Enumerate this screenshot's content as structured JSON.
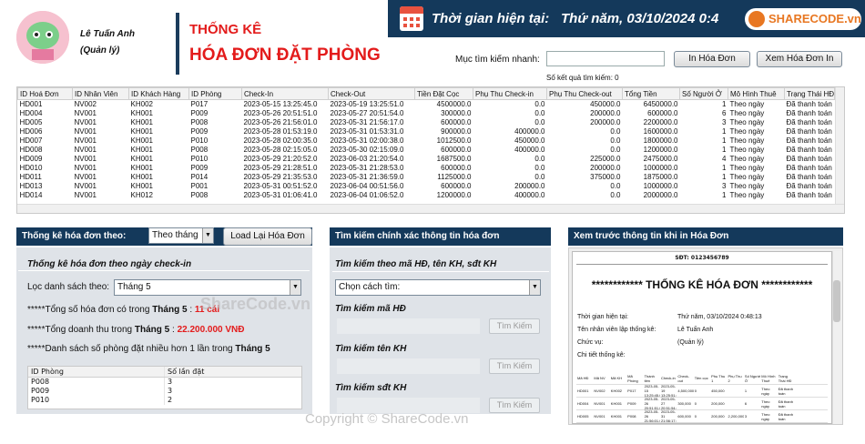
{
  "user": {
    "name": "Lê Tuấn Anh",
    "role": "(Quản lý)"
  },
  "title": {
    "line1": "THỐNG KÊ",
    "line2": "HÓA ĐƠN ĐẶT PHÒNG"
  },
  "time_bar": {
    "label": "Thời gian hiện tại:",
    "value": "Thứ năm, 03/10/2024 0:4",
    "logo": "SHARECODE.vn"
  },
  "search": {
    "label": "Mục tìm kiếm nhanh:",
    "value": "",
    "result_count": "Số kết quả tìm kiếm: 0",
    "print_label": "In Hóa Đơn",
    "preview_label": "Xem Hóa Đơn In"
  },
  "invoice_table": {
    "columns": [
      "ID Hoá Đơn",
      "ID Nhân Viên",
      "ID Khách Hàng",
      "ID Phòng",
      "Check-In",
      "Check-Out",
      "Tiền Đặt Cọc",
      "Phụ Thu Check-in",
      "Phụ Thu Check-out",
      "Tổng Tiền",
      "Số Người Ở",
      "Mô Hình Thuê",
      "Trạng Thái HĐ"
    ],
    "rows": [
      [
        "HD001",
        "NV002",
        "KH002",
        "P017",
        "2023-05-15 13:25:45.0",
        "2023-05-19 13:25:51.0",
        "4500000.0",
        "0.0",
        "450000.0",
        "6450000.0",
        "1",
        "Theo ngày",
        "Đã thanh toán"
      ],
      [
        "HD004",
        "NV001",
        "KH001",
        "P009",
        "2023-05-26 20:51:51.0",
        "2023-05-27 20:51:54.0",
        "300000.0",
        "0.0",
        "200000.0",
        "600000.0",
        "6",
        "Theo ngày",
        "Đã thanh toán"
      ],
      [
        "HD005",
        "NV001",
        "KH001",
        "P008",
        "2023-05-26 21:56:01.0",
        "2023-05-31 21:56:17.0",
        "600000.0",
        "0.0",
        "200000.0",
        "2200000.0",
        "3",
        "Theo ngày",
        "Đã thanh toán"
      ],
      [
        "HD006",
        "NV001",
        "KH001",
        "P009",
        "2023-05-28 01:53:19.0",
        "2023-05-31 01:53:31.0",
        "900000.0",
        "400000.0",
        "0.0",
        "1600000.0",
        "1",
        "Theo ngày",
        "Đã thanh toán"
      ],
      [
        "HD007",
        "NV001",
        "KH001",
        "P010",
        "2023-05-28 02:00:35.0",
        "2023-05-31 02:00:38.0",
        "1012500.0",
        "450000.0",
        "0.0",
        "1800000.0",
        "1",
        "Theo ngày",
        "Đã thanh toán"
      ],
      [
        "HD008",
        "NV001",
        "KH001",
        "P008",
        "2023-05-28 02:15:05.0",
        "2023-05-30 02:15:09.0",
        "600000.0",
        "400000.0",
        "0.0",
        "1200000.0",
        "1",
        "Theo ngày",
        "Đã thanh toán"
      ],
      [
        "HD009",
        "NV001",
        "KH001",
        "P010",
        "2023-05-29 21:20:52.0",
        "2023-06-03 21:20:54.0",
        "1687500.0",
        "0.0",
        "225000.0",
        "2475000.0",
        "4",
        "Theo ngày",
        "Đã thanh toán"
      ],
      [
        "HD010",
        "NV001",
        "KH001",
        "P009",
        "2023-05-29 21:28:51.0",
        "2023-05-31 21:28:53.0",
        "600000.0",
        "0.0",
        "200000.0",
        "1000000.0",
        "1",
        "Theo ngày",
        "Đã thanh toán"
      ],
      [
        "HD011",
        "NV001",
        "KH001",
        "P014",
        "2023-05-29 21:35:53.0",
        "2023-05-31 21:36:59.0",
        "1125000.0",
        "0.0",
        "375000.0",
        "1875000.0",
        "1",
        "Theo ngày",
        "Đã thanh toán"
      ],
      [
        "HD013",
        "NV001",
        "KH001",
        "P001",
        "2023-05-31 00:51:52.0",
        "2023-06-04 00:51:56.0",
        "600000.0",
        "200000.0",
        "0.0",
        "1000000.0",
        "3",
        "Theo ngày",
        "Đã thanh toán"
      ],
      [
        "HD014",
        "NV001",
        "KH012",
        "P008",
        "2023-05-31 01:06:41.0",
        "2023-06-04 01:06:52.0",
        "1200000.0",
        "400000.0",
        "0.0",
        "2000000.0",
        "1",
        "Theo ngày",
        "Đã thanh toán"
      ]
    ]
  },
  "stats_panel": {
    "header": "Thống kê hóa đơn theo:",
    "period": "Theo tháng",
    "reload_label": "Load Lại Hóa Đơn",
    "subtitle": "Thống kê hóa đơn theo ngày check-in",
    "filter_label": "Lọc danh sách theo:",
    "filter_value": "Tháng 5",
    "count_prefix": "*****Tổng số hóa đơn có trong ",
    "count_month": "Tháng 5",
    "count_sep": " : ",
    "count_value": "11 cái",
    "revenue_prefix": "*****Tổng doanh thu trong ",
    "revenue_month": "Tháng 5",
    "revenue_sep": " : ",
    "revenue_value": "22.200.000 VNĐ",
    "rooms_prefix": "*****Danh sách số phòng đặt nhiều hơn 1 lần trong ",
    "rooms_month": "Tháng 5",
    "rooms_columns": [
      "ID Phòng",
      "Số lần đặt"
    ],
    "rooms": [
      [
        "P008",
        "3"
      ],
      [
        "P009",
        "3"
      ],
      [
        "P010",
        "2"
      ]
    ]
  },
  "search_panel": {
    "header": "Tìm kiếm chính xác thông tin hóa đơn",
    "subtitle": "Tìm kiếm theo mã HĐ, tên KH, sđt KH",
    "method_placeholder": "Chọn cách tìm:",
    "by_id_label": "Tìm kiếm mã HĐ",
    "by_name_label": "Tìm kiếm tên KH",
    "by_phone_label": "Tìm kiếm sđt KH",
    "search_button": "Tìm Kiếm"
  },
  "preview_panel": {
    "header": "Xem trước thông tin khi in Hóa Đơn",
    "phone": "SĐT: 0123456789",
    "title": "************ THỐNG KÊ HÓA ĐƠN ************",
    "fields": [
      {
        "label": "Thời gian hiện tại:",
        "value": "Thứ năm, 03/10/2024 0:48:13"
      },
      {
        "label": "Tên nhân viên lập thống kê:",
        "value": "Lê Tuấn Anh"
      },
      {
        "label": "Chức vụ:",
        "value": "(Quản lý)"
      },
      {
        "label": "Chi tiết thống kê:",
        "value": ""
      }
    ],
    "mini_columns": [
      "Mã HĐ",
      "Mã NV",
      "Mã KH",
      "Mã Phòng",
      "Thành tiền",
      "Check-in",
      "Check-out",
      "Tiền cọc",
      "Phụ Thu 1",
      "Phụ Thu 2",
      "Số Người Ở",
      "Mô Hình Thuê",
      "Trạng Thái HĐ"
    ],
    "mini_rows": [
      [
        "HD001",
        "NV002",
        "KH002",
        "P017",
        "2023-05-15 13:25:45.0",
        "2023-05-19 13:25:51.0",
        "4,500,000",
        "0",
        "450,000",
        "",
        "1",
        "Theo ngày",
        "Đã thanh toán"
      ],
      [
        "HD004",
        "NV001",
        "KH001",
        "P009",
        "2023-05-26 20:51:51.0",
        "2023-05-27 20:51:54.0",
        "300,000",
        "0",
        "200,000",
        "",
        "6",
        "Theo ngày",
        "Đã thanh toán"
      ],
      [
        "HD005",
        "NV001",
        "KH001",
        "P008",
        "2023-05-26 21:56:01.0",
        "2023-05-31 21:56:17.0",
        "600,000",
        "0",
        "200,000",
        "2,200,000",
        "3",
        "Theo ngày",
        "Đã thanh toán"
      ]
    ]
  },
  "watermarks": {
    "center": "ShareCode.vn",
    "bottom": "Copyright © ShareCode.vn"
  }
}
